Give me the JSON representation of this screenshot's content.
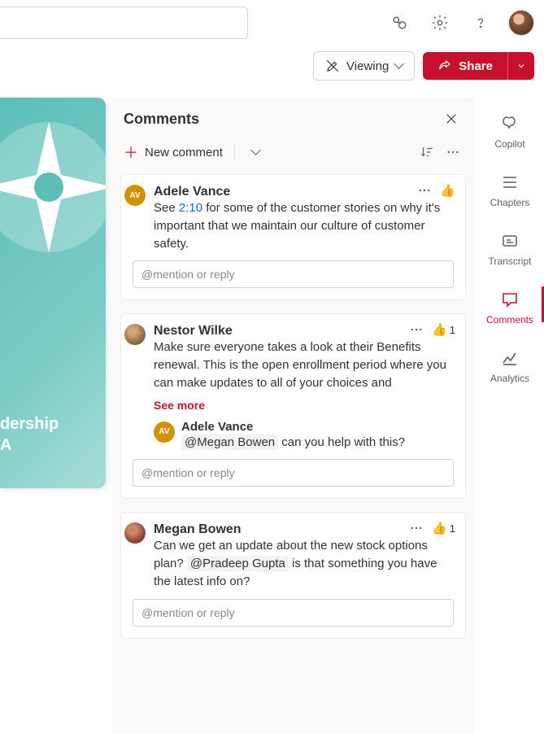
{
  "header": {
    "viewing_label": "Viewing",
    "share_label": "Share"
  },
  "rail": {
    "copilot": "Copilot",
    "chapters": "Chapters",
    "transcript": "Transcript",
    "comments": "Comments",
    "analytics": "Analytics"
  },
  "doc": {
    "line1": "dership",
    "line2": "A"
  },
  "panel": {
    "title": "Comments",
    "new_comment": "New comment",
    "reply_placeholder": "@mention or reply",
    "see_more": "See more"
  },
  "comments": [
    {
      "author": "Adele Vance",
      "avatar_initials": "AV",
      "body_pre": "See ",
      "timestamp": "2:10",
      "body_post": " for some of the customer stories on why it's important that we maintain our culture of customer safety.",
      "reactions": ""
    },
    {
      "author": "Nestor Wilke",
      "body": "Make sure everyone takes a look at their Benefits renewal. This is the open enrollment period where you can make updates to all of your choices and",
      "reactions": "1",
      "reply": {
        "author": "Adele Vance",
        "avatar_initials": "AV",
        "mention": "@Megan Bowen",
        "body_post": " can you help with this?"
      }
    },
    {
      "author": "Megan Bowen",
      "body_pre": "Can we get an update about the new stock options plan? ",
      "mention": "@Pradeep Gupta",
      "body_post": " is that something you have the latest info on?",
      "reactions": "1"
    }
  ]
}
